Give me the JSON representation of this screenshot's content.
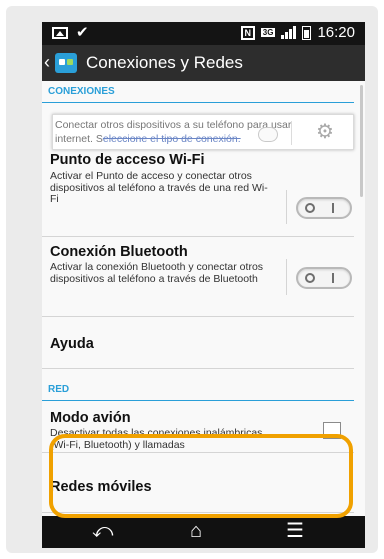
{
  "status_bar": {
    "time": "16:20",
    "network_type": "3G",
    "nfc_label": "N",
    "left_icons": [
      "image-icon",
      "check-icon"
    ],
    "right_icons": [
      "nfc-icon",
      "signal-icon",
      "battery-icon"
    ]
  },
  "app_bar": {
    "title": "Conexiones y Redes",
    "back_icon": "chevron-left-icon",
    "app_icon": "app-icon"
  },
  "colors": {
    "accent": "#2a9fd8",
    "highlight": "#f0a100",
    "status_bar_bg": "#141414",
    "app_bar_bg": "#2d2d2d",
    "nav_bar_bg": "#111111"
  },
  "sections": {
    "conexiones_header": "CONEXIONES",
    "red_header": "RED"
  },
  "hint_card": {
    "line1": "Conectar otros dispositivos a su teléfono para usar",
    "line2_prefix": "internet. S",
    "line2_link": "eleccione el tipo de conexión.",
    "icon": "gear-icon"
  },
  "settings": {
    "hotspot": {
      "title": "Punto de acceso Wi-Fi",
      "description": "Activar el Punto de acceso y conectar otros dispositivos al teléfono a través de una red Wi-Fi",
      "enabled": false
    },
    "bluetooth": {
      "title": "Conexión Bluetooth",
      "description": "Activar la conexión Bluetooth y conectar otros dispositivos al teléfono a través de Bluetooth",
      "enabled": false
    },
    "help": {
      "title": "Ayuda"
    },
    "airplane_mode": {
      "title": "Modo avión",
      "description": "Desactivar todas las conexiones inalámbricas (Wi-Fi, Bluetooth) y llamadas",
      "checked": false
    },
    "mobile_networks": {
      "title": "Redes móviles"
    }
  },
  "nav_bar": {
    "icons": [
      "back-icon",
      "home-icon",
      "menu-icon"
    ]
  }
}
